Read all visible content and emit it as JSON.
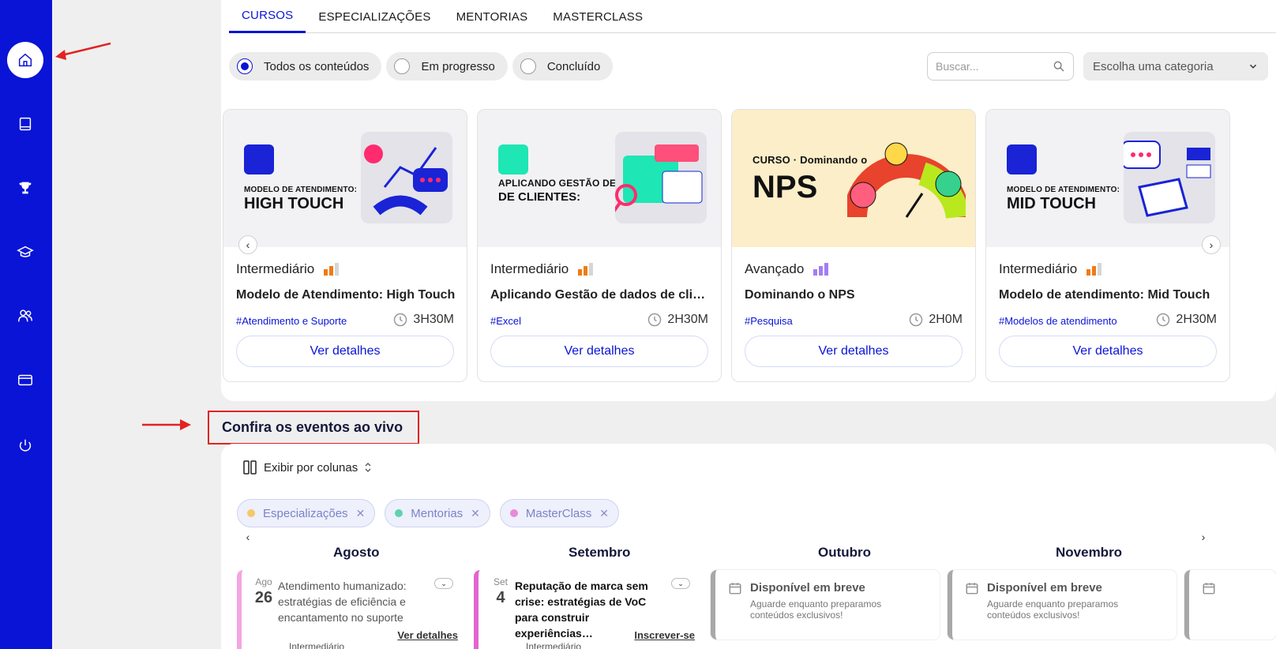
{
  "sidebar": {
    "items": [
      {
        "icon": "home-icon",
        "name": "sidebar-item-home",
        "active": true
      },
      {
        "icon": "book-icon",
        "name": "sidebar-item-library"
      },
      {
        "icon": "trophy-icon",
        "name": "sidebar-item-achievements"
      },
      {
        "icon": "graduation-cap-icon",
        "name": "sidebar-item-certificates"
      },
      {
        "icon": "users-icon",
        "name": "sidebar-item-community"
      },
      {
        "icon": "credit-card-icon",
        "name": "sidebar-item-billing"
      },
      {
        "icon": "power-icon",
        "name": "sidebar-item-logout"
      }
    ]
  },
  "tabs": [
    "CURSOS",
    "ESPECIALIZAÇÕES",
    "MENTORIAS",
    "MASTERCLASS"
  ],
  "filters": [
    "Todos os conteúdos",
    "Em progresso",
    "Concluído"
  ],
  "search": {
    "placeholder": "Buscar..."
  },
  "category": {
    "label": "Escolha uma categoria"
  },
  "cards": [
    {
      "thumb_line1": "MODELO DE ATENDIMENTO:",
      "thumb_line2": "HIGH TOUCH",
      "level": "Intermediário",
      "level_bars": 2,
      "level_color": "#f07b16",
      "title": "Modelo de Atendimento: High Touch",
      "tag": "#Atendimento e Suporte",
      "duration": "3H30M",
      "button": "Ver detalhes"
    },
    {
      "thumb_line1": "APLICANDO GESTÃO DE DADOS",
      "thumb_line2": "DE CLIENTES:",
      "level": "Intermediário",
      "level_bars": 2,
      "level_color": "#f07b16",
      "title": "Aplicando Gestão de dados de clientes",
      "tag": "#Excel",
      "duration": "2H30M",
      "button": "Ver detalhes"
    },
    {
      "thumb_line1": "CURSO · Dominando o",
      "thumb_line2": "NPS",
      "level": "Avançado",
      "level_bars": 3,
      "level_color": "#a47ef0",
      "title": "Dominando o NPS",
      "tag": "#Pesquisa",
      "duration": "2H0M",
      "button": "Ver detalhes"
    },
    {
      "thumb_line1": "MODELO DE ATENDIMENTO:",
      "thumb_line2": "MID TOUCH",
      "level": "Intermediário",
      "level_bars": 2,
      "level_color": "#f07b16",
      "title": "Modelo de atendimento: Mid Touch",
      "tag": "#Modelos de atendimento",
      "duration": "2H30M",
      "button": "Ver detalhes"
    }
  ],
  "events": {
    "title": "Confira os eventos ao vivo",
    "view_toggle": "Exibir por colunas",
    "chips": [
      {
        "label": "Especializações",
        "color": "#f5c86a"
      },
      {
        "label": "Mentorias",
        "color": "#5fd3ae"
      },
      {
        "label": "MasterClass",
        "color": "#e88ad8"
      }
    ],
    "months": [
      "Agosto",
      "Setembro",
      "Outubro",
      "Novembro"
    ],
    "items": [
      {
        "month_abbr": "Ago",
        "day": "26",
        "text": "Atendimento humanizado: estratégias de eficiência e encantamento no suporte",
        "link": "Ver detalhes",
        "level": "Intermediário",
        "color": "#f2a6e3"
      },
      {
        "month_abbr": "Set",
        "day": "4",
        "text": "Reputação de marca sem crise: estratégias de VoC para construir experiências…",
        "link": "Inscrever-se",
        "level": "Intermediário",
        "color": "#e264cf"
      }
    ],
    "soon": {
      "title": "Disponível em breve",
      "desc": "Aguarde enquanto preparamos conteúdos exclusivos!"
    }
  }
}
